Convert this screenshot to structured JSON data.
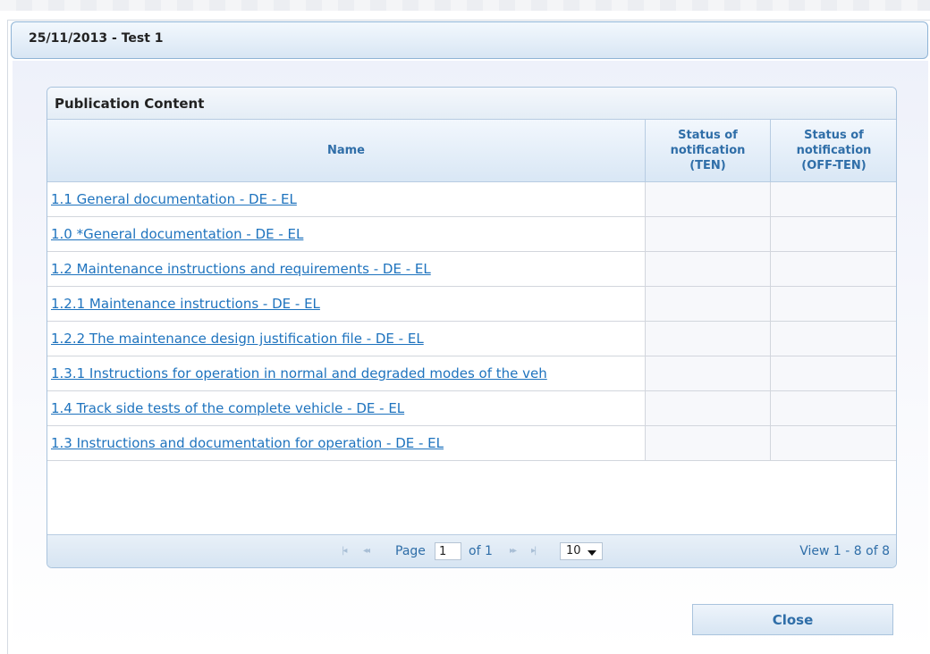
{
  "dialog": {
    "title": "25/11/2013 - Test 1"
  },
  "grid": {
    "caption": "Publication Content",
    "columns": {
      "name": "Name",
      "ten": [
        "Status of",
        "notification",
        "(TEN)"
      ],
      "off_ten": [
        "Status of",
        "notification",
        "(OFF-TEN)"
      ]
    },
    "rows": [
      {
        "name": "1.1 General documentation - DE - EL",
        "ten": "",
        "off_ten": ""
      },
      {
        "name": "1.0 *General documentation - DE - EL",
        "ten": "",
        "off_ten": ""
      },
      {
        "name": "1.2 Maintenance instructions and requirements - DE - EL",
        "ten": "",
        "off_ten": ""
      },
      {
        "name": "1.2.1 Maintenance instructions - DE - EL",
        "ten": "",
        "off_ten": ""
      },
      {
        "name": "1.2.2 The maintenance design justification file - DE - EL",
        "ten": "",
        "off_ten": ""
      },
      {
        "name": "1.3.1 Instructions for operation in normal and degraded  modes of the veh",
        "ten": "",
        "off_ten": ""
      },
      {
        "name": "1.4 Track side tests of the complete vehicle - DE - EL",
        "ten": "",
        "off_ten": ""
      },
      {
        "name": "1.3 Instructions  and documentation for operation - DE - EL",
        "ten": "",
        "off_ten": ""
      }
    ],
    "pager": {
      "page_label": "Page",
      "page_value": "1",
      "of_label": "of 1",
      "rows_per_page": "10",
      "view_text": "View 1 - 8 of 8",
      "icons": [
        "first-page-icon",
        "prev-page-icon",
        "next-page-icon",
        "last-page-icon"
      ]
    }
  },
  "close_label": "Close",
  "colors": {
    "header_text": "#2f6ea8",
    "link": "#1e73be",
    "border": "#a9c3dd"
  }
}
